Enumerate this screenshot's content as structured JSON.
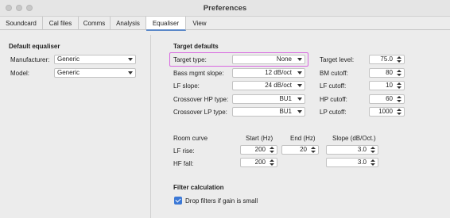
{
  "window": {
    "title": "Preferences"
  },
  "tabs": [
    "Soundcard",
    "Cal files",
    "Comms",
    "Analysis",
    "Equaliser",
    "View"
  ],
  "active_tab": "Equaliser",
  "default_equaliser": {
    "heading": "Default equaliser",
    "manufacturer_label": "Manufacturer:",
    "manufacturer_value": "Generic",
    "model_label": "Model:",
    "model_value": "Generic"
  },
  "target_defaults": {
    "heading": "Target defaults",
    "target_type_label": "Target type:",
    "target_type_value": "None",
    "bass_label": "Bass mgmt slope:",
    "bass_value": "12 dB/oct",
    "lf_slope_label": "LF slope:",
    "lf_slope_value": "24 dB/oct",
    "xhp_label": "Crossover HP type:",
    "xhp_value": "BU1",
    "xlp_label": "Crossover LP type:",
    "xlp_value": "BU1",
    "target_level_label": "Target level:",
    "target_level_value": "75.0",
    "bm_cutoff_label": "BM cutoff:",
    "bm_cutoff_value": "80",
    "lf_cutoff_label": "LF cutoff:",
    "lf_cutoff_value": "10",
    "hp_cutoff_label": "HP cutoff:",
    "hp_cutoff_value": "60",
    "lp_cutoff_label": "LP cutoff:",
    "lp_cutoff_value": "1000"
  },
  "room_curve": {
    "label": "Room curve",
    "col_start": "Start (Hz)",
    "col_end": "End (Hz)",
    "col_slope": "Slope (dB/Oct.)",
    "lf_rise_label": "LF rise:",
    "lf_rise_start": "200",
    "lf_rise_end": "20",
    "lf_rise_slope": "3.0",
    "hf_fall_label": "HF fall:",
    "hf_fall_start": "200",
    "hf_fall_slope": "3.0"
  },
  "filter_calc": {
    "heading": "Filter calculation",
    "drop_label": "Drop filters if gain is small",
    "drop_checked": true
  }
}
